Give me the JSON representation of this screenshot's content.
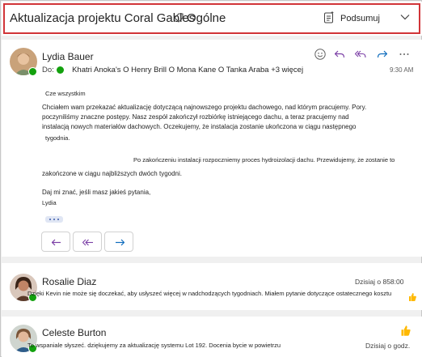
{
  "header": {
    "subject": "Aktualizacja projektu Coral Gables",
    "tag_label": "Ogólne",
    "summarize_label": "Podsumuj"
  },
  "email1": {
    "sender": "Lydia Bauer",
    "to_label": "Do:",
    "recipients": "Khatri Anoka's O Henry Brill O Mona Kane O Tanka Araba +3 więcej",
    "time": "9:30 AM",
    "greeting": "Cze wszystkim",
    "para1_line1": "Chciałem wam przekazać aktualizację dotyczącą najnowszego projektu dachowego, nad którym pracujemy. Pory.",
    "para1_line2": "poczyniliśmy znaczne postępy. Nasz zespół zakończył rozbiórkę istniejącego dachu, a teraz pracujemy nad",
    "para1_line3": "instalacją nowych materiałów dachowych. Oczekujemy, że instalacja zostanie ukończona w ciągu następnego",
    "para1_line4": "tygodnia.",
    "para2_line1": "Po zakończeniu instalacji rozpoczniemy proces hydroizolacji dachu. Przewidujemy, że zostanie to",
    "para2_line2": "zakończone w ciągu najbliższych dwóch tygodni.",
    "closing": "Daj mi znać, jeśli masz jakieś pytania,",
    "signature": "Lydia"
  },
  "email2": {
    "sender": "Rosalie Diaz",
    "meta": "Dzisiaj o 858:00",
    "preview": "Dzięki Kevin nie może się doczekać, aby usłyszeć więcej w nadchodzących tygodniach. Miałem pytanie dotyczące ostatecznego kosztu"
  },
  "email3": {
    "sender": "Celeste Burton",
    "meta": "Dzisiaj o godz.",
    "preview": "To wspaniale słyszeć. dziękujemy za aktualizację systemu Lot 192. Docenia bycie w powietrzu"
  },
  "icons": {
    "tag": "tag-icon",
    "summarize": "summarize-icon",
    "emoji": "smiley-icon",
    "reply": "reply-icon",
    "reply_all": "reply-all-icon",
    "forward": "forward-icon",
    "more": "more-icon",
    "reaction": "thumbs-up-icon"
  },
  "colors": {
    "accent": "#7b3fa6",
    "presence": "#13a10e",
    "highlight_border": "#d13438"
  }
}
